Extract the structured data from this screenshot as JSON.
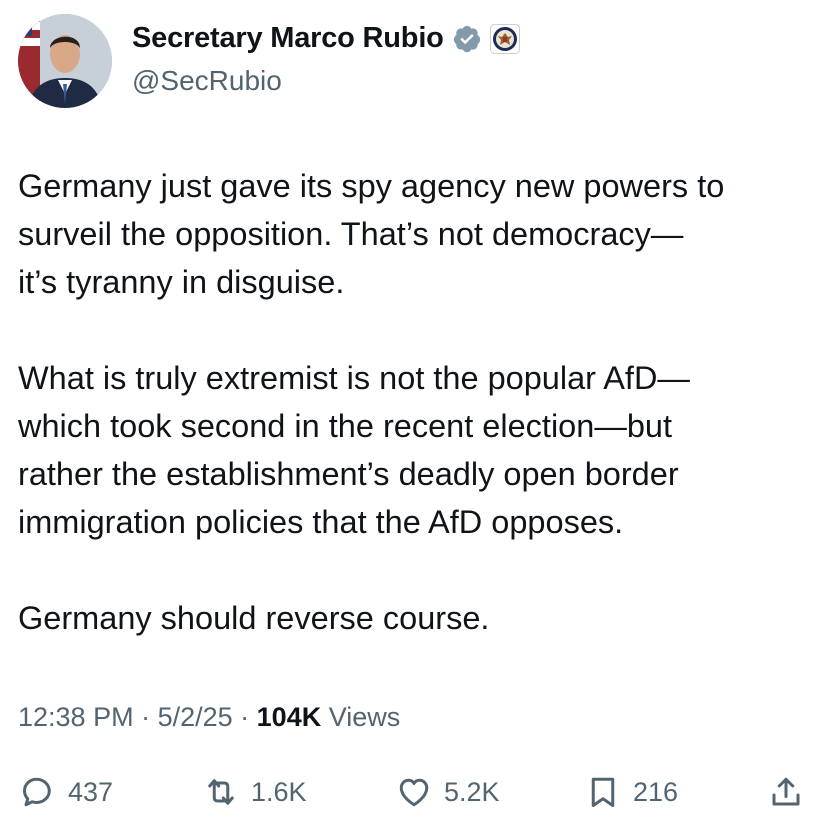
{
  "author": {
    "display_name": "Secretary Marco Rubio",
    "handle": "@SecRubio",
    "verified_icon": "verified-badge-icon",
    "affiliation_icon": "state-department-seal-icon"
  },
  "tweet": {
    "paragraphs": [
      "Germany just gave its spy agency new powers to\nsurveil the opposition.  That’s not democracy—\nit’s tyranny in disguise.",
      "What is truly extremist is not the popular AfD—\nwhich took second in the recent election—but\nrather the establishment’s deadly open border\nimmigration policies that the AfD opposes.",
      "Germany should reverse course."
    ]
  },
  "meta": {
    "time": "12:38 PM",
    "sep1": " · ",
    "date": "5/2/25",
    "sep2": " · ",
    "views_count": "104K",
    "views_label": " Views"
  },
  "actions": {
    "replies": "437",
    "reposts": "1.6K",
    "likes": "5.2K",
    "bookmarks": "216"
  },
  "colors": {
    "text": "#0f1419",
    "secondary": "#536471",
    "verified": "#829aab"
  }
}
